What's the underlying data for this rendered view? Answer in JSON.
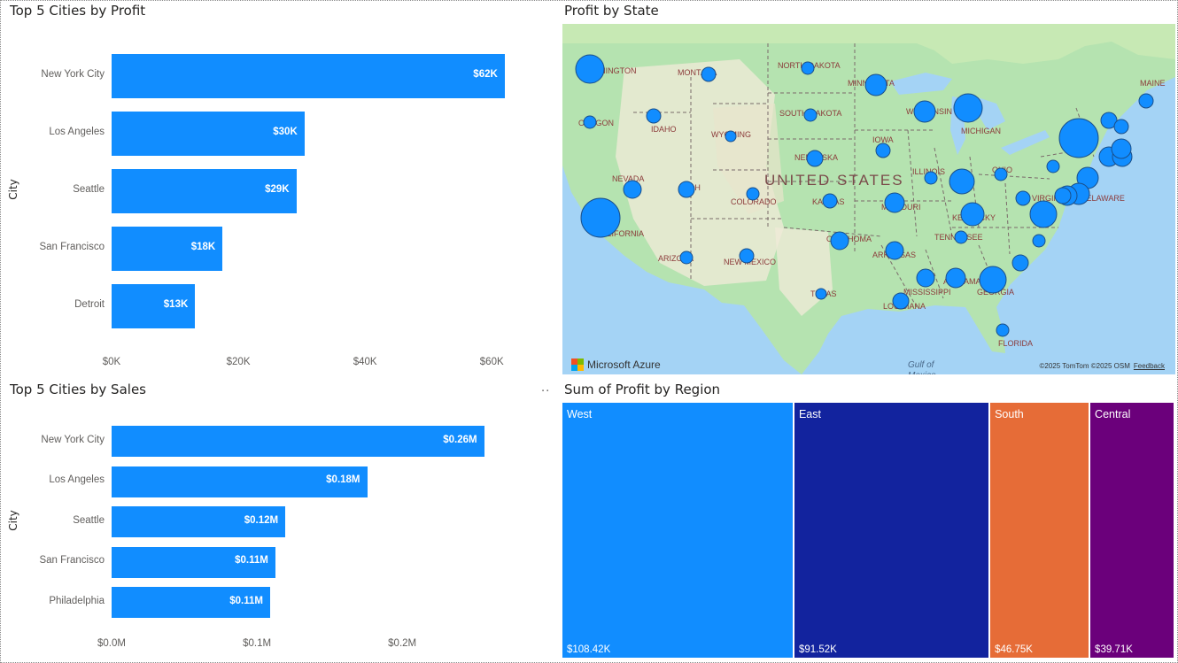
{
  "profit_chart": {
    "title": "Top 5 Cities by Profit",
    "ylabel": "City",
    "more_icon": "",
    "chart_data": {
      "type": "bar",
      "orientation": "horizontal",
      "title": "Top 5 Cities by Profit",
      "ylabel": "City",
      "xlabel": "",
      "categories": [
        "New York City",
        "Los Angeles",
        "Seattle",
        "San Francisco",
        "Detroit"
      ],
      "values": [
        62037,
        30441,
        29156,
        17507,
        13181
      ],
      "data_labels": [
        "$62K",
        "$30K",
        "$29K",
        "$18K",
        "$13K"
      ],
      "x_ticks": [
        "$0K",
        "$20K",
        "$40K",
        "$60K"
      ],
      "x_tick_values": [
        0,
        20000,
        40000,
        60000
      ],
      "xlim": [
        0,
        65000
      ],
      "grid": false,
      "color": "#118dff"
    }
  },
  "sales_chart": {
    "title": "Top 5 Cities by Sales",
    "ylabel": "City",
    "more_icon": "··",
    "chart_data": {
      "type": "bar",
      "orientation": "horizontal",
      "title": "Top 5 Cities by Sales",
      "ylabel": "City",
      "xlabel": "",
      "categories": [
        "New York City",
        "Los Angeles",
        "Seattle",
        "San Francisco",
        "Philadelphia"
      ],
      "values": [
        256368,
        175851,
        119541,
        112669,
        109077
      ],
      "data_labels": [
        "$0.26M",
        "$0.18M",
        "$0.12M",
        "$0.11M",
        "$0.11M"
      ],
      "x_ticks": [
        "$0.0M",
        "$0.1M",
        "$0.2M"
      ],
      "x_tick_values": [
        0,
        100000,
        200000
      ],
      "xlim": [
        0,
        270000
      ],
      "grid": false,
      "color": "#118dff"
    }
  },
  "map": {
    "title": "Profit by State",
    "country_label": "UNITED STATES",
    "provider": "Microsoft Azure",
    "copyright": "©2025 TomTom  ©2025 OSM",
    "feedback": "Feedback",
    "gulf_label": "Gulf of",
    "gulf_label2": "Mexico",
    "colors": {
      "water": "#a4d3f5",
      "land": "#b5e3b0",
      "bubble": "#118dff"
    },
    "state_labels": [
      "MONTANA",
      "NORTH DAKOTA",
      "MINNESOTA",
      "OREGON",
      "IDAHO",
      "SOUTH DAKOTA",
      "WISCONSIN",
      "MICHIGAN",
      "WYOMING",
      "IOWA",
      "NEBRASKA",
      "NEVADA",
      "UTAH",
      "ILLINOIS",
      "OHIO",
      "COLORADO",
      "KANSAS",
      "MISSOURI",
      "KENTUCKY",
      "VIRGINIA",
      "CALIFORNIA",
      "OKLAHOMA",
      "TENNESSEE",
      "ARKANSAS",
      "ARIZONA",
      "NEW MEXICO",
      "ALABAMA",
      "GEORGIA",
      "MISSISSIPPI",
      "TEXAS",
      "LOUISIANA",
      "FLORIDA",
      "WASHINGTON",
      "MAINE",
      "DELAWARE"
    ]
  },
  "treemap": {
    "title": "Sum of Profit by Region",
    "chart_data": {
      "type": "treemap",
      "title": "Sum of Profit by Region",
      "categories": [
        "West",
        "East",
        "South",
        "Central"
      ],
      "values": [
        108418,
        91523,
        46749,
        39706
      ],
      "data_labels": [
        "$108.42K",
        "$91.52K",
        "$46.75K",
        "$39.71K"
      ],
      "colors": [
        "#118dff",
        "#12239e",
        "#e66c37",
        "#6b007b"
      ]
    }
  }
}
